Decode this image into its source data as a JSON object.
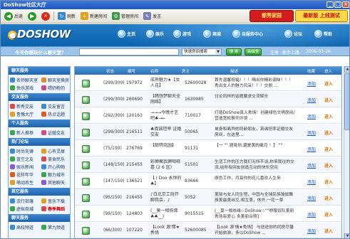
{
  "window": {
    "title": "DoShow社区大厅",
    "minimize": "_",
    "maximize": "□",
    "close": "×"
  },
  "toolbar": {
    "back": "后退",
    "refresh": "刷新",
    "new_room": "新建房间",
    "manage_room": "管理房间",
    "speak": "发言"
  },
  "promo": {
    "family": "都秀家园",
    "highlight": "最新版 上线测试"
  },
  "header": {
    "logo": "DOSHOW",
    "nav": [
      "主页",
      "娱乐",
      "游戏",
      "商城",
      "自服务中心",
      "论坛",
      "帮助"
    ]
  },
  "search": {
    "question": "今天你想玩什么聊天室？",
    "value": "",
    "select": "快速房间搜索",
    "go": "搜 索",
    "advanced": "高级查",
    "register": "注册",
    "guide": "新手上路",
    "date": "2006-03-26"
  },
  "sidebar": {
    "sections": [
      {
        "title": "聊天服务",
        "items": [
          "名师聊天室",
          "聊天室换房",
          "快乐游戏",
          "喂奶粉的"
        ]
      },
      {
        "title": "交友服务",
        "items": [
          "新秀交友",
          "交友留言",
          "鲁豫大厅",
          "热点话题"
        ]
      },
      {
        "title": "个人服务",
        "items": [
          "新人推荐",
          "证婚交友"
        ]
      },
      {
        "title": "热门论坛",
        "items": [
          "时尚先锋",
          "心有灵犀",
          "蓝空之友",
          "美食民乐",
          "娱乐新闻",
          "开心购物",
          "花样年华",
          "魅力城市",
          "萌动后生",
          "其他聊天"
        ]
      },
      {
        "title": "其它服务",
        "items": [
          "流行部落",
          "音乐下载",
          "虚拟商城",
          "春季舞蹈"
        ]
      },
      {
        "title": "聊天服务",
        "items": [
          "高校频道",
          "第九频道"
        ]
      }
    ]
  },
  "table": {
    "columns": [
      "状态",
      "编号",
      "名称",
      "房主",
      "描述",
      "收藏",
      "进入"
    ],
    "add_label": "添加",
    "enter_label": "进入",
    "rows": [
      {
        "count": "(299/300)",
        "id": "197972",
        "name": "成熟魅力★【女人花】",
        "owner": "52600028",
        "desc": "首先温馨祝福！！！喝出你精彩调味！！！秀出女人的魅力风采！！！交朋 ..."
      },
      {
        "count": "(299/300)",
        "id": "260690",
        "name": "【畅想梦聊天全网络】",
        "owner": "1630985",
        "desc": "讨论同样的话题要求交流娱乐"
      },
      {
        "count": "(292/300)",
        "id": "120163",
        "name": "→→→今晚才艺吧♣→←",
        "owner": "710017",
        "desc": "打造DoShow真人秀场！创建绿色文明房间/营造宽松聊天环境 ..."
      },
      {
        "count": "(299/300)",
        "id": "216511",
        "name": "♣真诚坦率 证婚交友",
        "owner": "50065",
        "desc": "单身和离异的同龄朋友，真诚坦率证婚交友房间，在这里..."
      },
      {
        "count": "(75/150)",
        "id": "276769",
        "name": "【聪明花园】",
        "owner": "91131",
        "desc": "【一 \"\" 週見你,還是美的歲月 ！】 \"\""
      },
      {
        "count": "(148/150)",
        "id": "215455",
        "name": "彩狮聚我狮喝释喜 (2 6 区)",
        "owner": "51501",
        "desc": "生活工作的压力我们无所不谈,你来我往的交流,给所有网友创造互动的快乐空间"
      },
      {
        "count": "(147/150)",
        "id": "136521",
        "name": "【 I Doo 永恒的 ♣】",
        "owner": "83666",
        "desc": "原色工作，月亮你的花儿喜欢人生来"
      },
      {
        "count": "(95/150)",
        "id": "216455",
        "name": "♪白北京工府开聊我会，♪",
        "owner": "5052",
        "desc": "美丽与女人同生悟，中国与全球民族瑜伽舞族美最美丝互,相互美，体外,一花一草"
      },
      {
        "count": "(99/150)",
        "id": "124803",
        "name": "(__莫一相依缘 ♣♣__)",
        "owner": "9015515",
        "desc": "(__莫一相依缘☆DoShow☆\"\"咿服设队美丽秀场有爱心 多美丽合照]"
      },
      {
        "count": "(66/300)",
        "id": "107220",
        "name": "【Look 源'情★秀场",
        "owner": "52600085",
        "desc": "【Look 源'情★秀场】 与途途你的同房尽量开始旅游，多以DoShow ..."
      }
    ]
  },
  "colors": {
    "titlebar": "#1d55c3",
    "header": "#0b63ad",
    "sidebar_head": "#1d62ad",
    "accent_orange": "#e07000",
    "link_blue": "#1155cc",
    "promo_red": "#d41c1c"
  }
}
